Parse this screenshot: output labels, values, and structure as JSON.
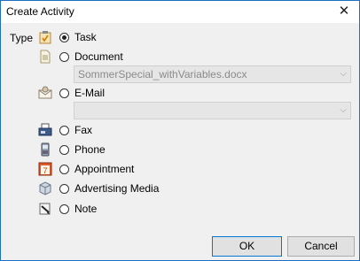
{
  "window": {
    "title": "Create Activity"
  },
  "form": {
    "type_label": "Type",
    "options": [
      {
        "label": "Task",
        "checked": true,
        "icon": "task-icon"
      },
      {
        "label": "Document",
        "checked": false,
        "icon": "document-icon"
      },
      {
        "label": "E-Mail",
        "checked": false,
        "icon": "email-icon"
      },
      {
        "label": "Fax",
        "checked": false,
        "icon": "fax-icon"
      },
      {
        "label": "Phone",
        "checked": false,
        "icon": "phone-icon"
      },
      {
        "label": "Appointment",
        "checked": false,
        "icon": "appointment-icon"
      },
      {
        "label": "Advertising Media",
        "checked": false,
        "icon": "advertising-media-icon"
      },
      {
        "label": "Note",
        "checked": false,
        "icon": "note-icon"
      }
    ],
    "document_select_value": "SommerSpecial_withVariables.docx",
    "email_select_value": "",
    "appointment_icon_text": "7"
  },
  "buttons": {
    "ok": "OK",
    "cancel": "Cancel"
  }
}
